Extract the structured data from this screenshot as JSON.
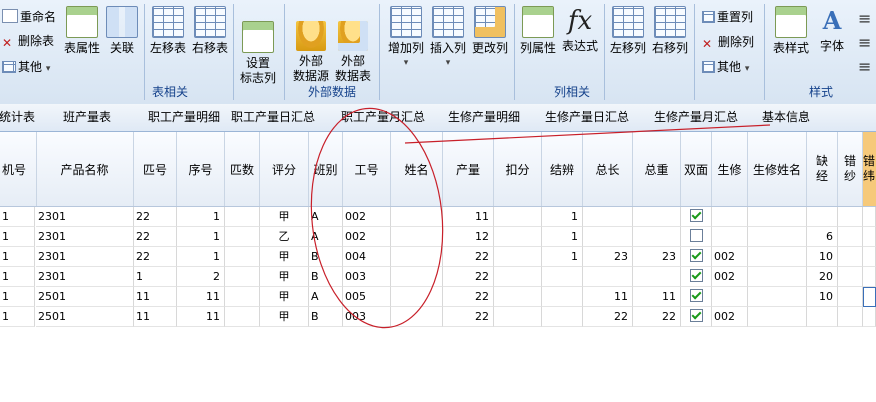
{
  "ribbon": {
    "left_small": [
      {
        "label": "重命名",
        "icon": "rename-icon"
      },
      {
        "label": "删除表",
        "icon": "delete-table-icon"
      },
      {
        "label": "其他",
        "icon": "other-icon"
      }
    ],
    "table_group": {
      "label": "表相关",
      "buttons": [
        "表属性",
        "关联",
        "左移表",
        "右移表",
        "设置\n标志列"
      ]
    },
    "ext_group": {
      "label": "外部数据",
      "buttons": [
        "外部\n数据源",
        "外部\n数据表"
      ]
    },
    "col_group": {
      "label": "列相关",
      "buttons": [
        "增加列",
        "插入列",
        "更改列",
        "列属性",
        "表达式",
        "左移列",
        "右移列"
      ],
      "small": [
        {
          "label": "重置列",
          "icon": "reset-column-icon"
        },
        {
          "label": "删除列",
          "icon": "delete-column-icon"
        },
        {
          "label": "其他",
          "icon": "other-icon"
        }
      ]
    },
    "style_group": {
      "label": "样式",
      "buttons": [
        "表样式",
        "字体"
      ]
    }
  },
  "tabs": [
    "统计表",
    "班产量表",
    "职工产量明细",
    "职工产量日汇总",
    "职工产量月汇总",
    "生修产量明细",
    "生修产量日汇总",
    "生修产量月汇总",
    "基本信息"
  ],
  "grid": {
    "headers": [
      "机号",
      "产品名称",
      "匹号",
      "序号",
      "匹数",
      "评分",
      "班别",
      "工号",
      "姓名",
      "产量",
      "扣分",
      "结辨",
      "总长",
      "总重",
      "双面",
      "生修",
      "生修姓名",
      "缺\n经",
      "错\n纱",
      "错\n纬"
    ],
    "rows": [
      {
        "c": [
          "1",
          "2301",
          "22",
          "1",
          "",
          "甲",
          "A",
          "002",
          "",
          "11",
          "",
          "1",
          "",
          "",
          "",
          " ",
          "",
          "",
          "",
          ""
        ],
        "chk": true
      },
      {
        "c": [
          "1",
          "2301",
          "22",
          "1",
          "",
          "乙",
          "A",
          "002",
          "",
          "12",
          "",
          "1",
          "",
          "",
          "",
          " ",
          "",
          "6",
          "",
          ""
        ],
        "chk": false
      },
      {
        "c": [
          "1",
          "2301",
          "22",
          "1",
          "",
          "甲",
          "B",
          "004",
          "",
          "22",
          "",
          "1",
          "23",
          "23",
          "",
          "002",
          "",
          "10",
          "",
          ""
        ],
        "chk": true
      },
      {
        "c": [
          "1",
          "2301",
          "1",
          "2",
          "",
          "甲",
          "B",
          "003",
          "",
          "22",
          "",
          "",
          "",
          "",
          "",
          "002",
          "",
          "20",
          "",
          ""
        ],
        "chk": true
      },
      {
        "c": [
          "1",
          "2501",
          "11",
          "11",
          "",
          "甲",
          "A",
          "005",
          "",
          "22",
          "",
          "",
          "11",
          "11",
          "",
          "",
          "",
          "10",
          "",
          ""
        ],
        "chk": true
      },
      {
        "c": [
          "1",
          "2501",
          "11",
          "11",
          "",
          "甲",
          "B",
          "003",
          "",
          "22",
          "",
          "",
          "22",
          "22",
          "",
          "002",
          "",
          "",
          "",
          ""
        ],
        "chk": true
      }
    ]
  },
  "colors": {
    "annotation": "#c8202a",
    "group_label": "#15428b",
    "check": "#1a9a1a"
  }
}
